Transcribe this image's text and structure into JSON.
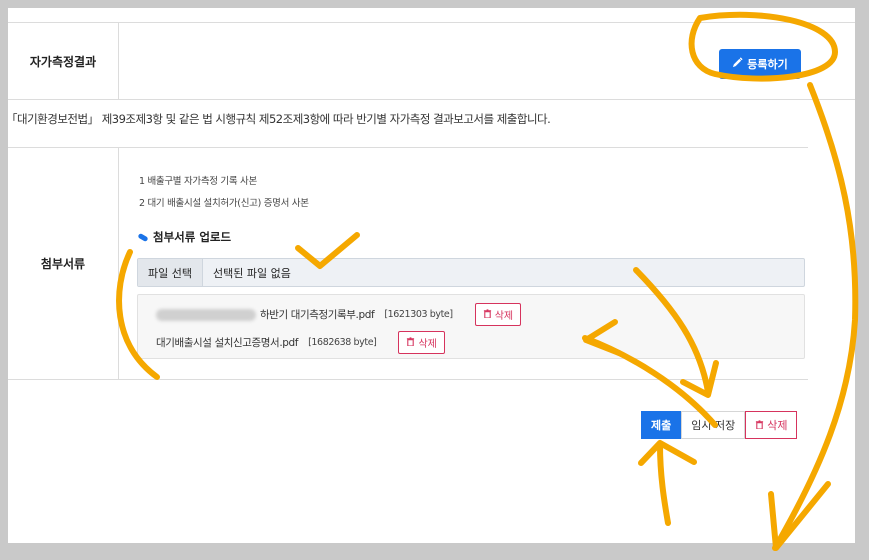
{
  "section": {
    "title": "자가측정결과",
    "register_button": "등록하기",
    "notice": "「대기환경보전법」 제39조제3항 및 같은 법 시행규칙 제52조제3항에 따라 반기별 자가측정 결과보고서를 제출합니다."
  },
  "attachments": {
    "title": "첨부서류",
    "requirements": [
      "1 배출구별 자가측정 기록 사본",
      "2 대기 배출시설 설치허가(신고) 증명서 사본"
    ],
    "upload_title": "첨부서류 업로드",
    "file_button": "파일 선택",
    "file_status": "선택된 파일 없음",
    "files": [
      {
        "name": "하반기 대기측정기록부.pdf",
        "size": "[1621303 byte]",
        "delete": "삭제"
      },
      {
        "name": "대기배출시설 설치신고증명서.pdf",
        "size": "[1682638 byte]",
        "delete": "삭제"
      }
    ]
  },
  "actions": {
    "submit": "제출",
    "temp_save": "임시 저장",
    "delete": "삭제"
  },
  "colors": {
    "accent": "#1a73e8",
    "danger": "#d6335d",
    "annotation": "#f5a800"
  }
}
